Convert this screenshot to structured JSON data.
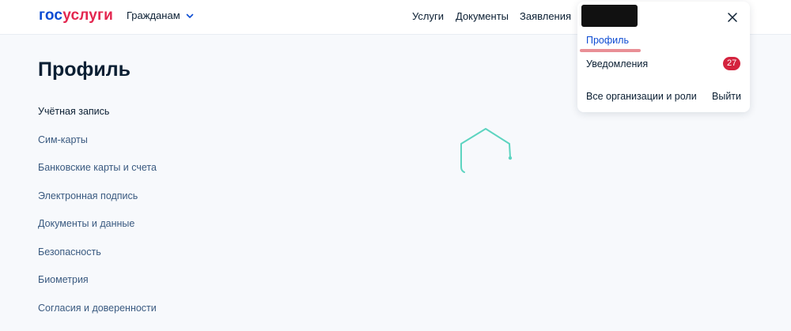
{
  "header": {
    "logo_part1": "гос",
    "logo_part2": "услуги",
    "citizen_menu": "Гражданам",
    "nav": [
      "Услуги",
      "Документы",
      "Заявления"
    ]
  },
  "page": {
    "title": "Профиль"
  },
  "sidebar": {
    "items": [
      "Учётная запись",
      "Сим-карты",
      "Банковские карты и счета",
      "Электронная подпись",
      "Документы и данные",
      "Безопасность",
      "Биометрия",
      "Согласия и доверенности"
    ]
  },
  "dropdown": {
    "profile": "Профиль",
    "notifications": "Уведомления",
    "notifications_count": "27",
    "organizations": "Все организации и роли",
    "exit": "Выйти"
  },
  "colors": {
    "brand_blue": "#0d4cd3",
    "brand_red": "#e3264f",
    "badge_red": "#d4233e",
    "spinner_teal": "#5dd4c0",
    "highlight_underline": "#e98f96"
  },
  "icons": {
    "close": "close-icon",
    "chevron": "chevron-down-icon",
    "loading": "loading-spinner-icon"
  }
}
